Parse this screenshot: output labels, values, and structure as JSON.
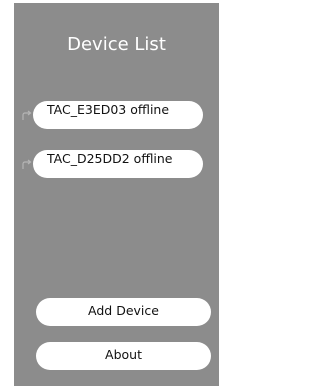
{
  "header": {
    "title": "Device List"
  },
  "devices": [
    {
      "name": "TAC_E3ED03",
      "status": "offline",
      "label": "TAC_E3ED03 offline",
      "icon": "share-icon"
    },
    {
      "name": "TAC_D25DD2",
      "status": "offline",
      "label": "TAC_D25DD2 offline",
      "icon": "share-icon"
    }
  ],
  "actions": {
    "add_device_label": "Add Device",
    "about_label": "About"
  },
  "colors": {
    "panel_background": "#8c8c8c",
    "pill_background": "#ffffff",
    "title_text": "#ffffff",
    "item_text": "#111111"
  }
}
